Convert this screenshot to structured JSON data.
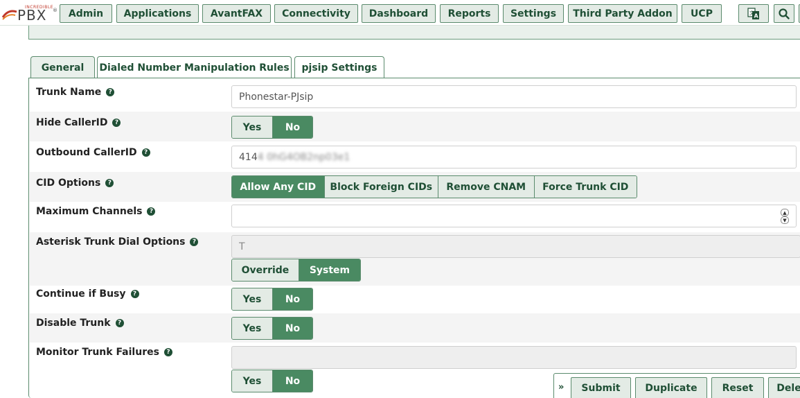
{
  "brand": {
    "small": "INCREDIBLE",
    "big": "PBX",
    "mark": "®"
  },
  "nav": [
    {
      "label": "Admin"
    },
    {
      "label": "Applications"
    },
    {
      "label": "AvantFAX"
    },
    {
      "label": "Connectivity"
    },
    {
      "label": "Dashboard"
    },
    {
      "label": "Reports"
    },
    {
      "label": "Settings"
    },
    {
      "label": "Third Party Addon"
    },
    {
      "label": "UCP"
    }
  ],
  "nav_icons": [
    "translate-icon",
    "search-icon"
  ],
  "tabs": [
    {
      "label": "General",
      "active": true
    },
    {
      "label": "Dialed Number Manipulation Rules",
      "active": false
    },
    {
      "label": "pjsip Settings",
      "active": false
    }
  ],
  "form": {
    "trunk_name": {
      "label": "Trunk Name",
      "value": "Phonestar-PJsip"
    },
    "hide_callerid": {
      "label": "Hide CallerID",
      "options": [
        "Yes",
        "No"
      ],
      "selected": "No"
    },
    "outbound_callerid": {
      "label": "Outbound CallerID",
      "value_prefix": "414",
      "value_blurred": "4 0hG4OB2np03e1"
    },
    "cid_options": {
      "label": "CID Options",
      "options": [
        "Allow Any CID",
        "Block Foreign CIDs",
        "Remove CNAM",
        "Force Trunk CID"
      ],
      "selected": "Allow Any CID"
    },
    "max_channels": {
      "label": "Maximum Channels",
      "value": ""
    },
    "dial_options": {
      "label": "Asterisk Trunk Dial Options",
      "value": "T",
      "options": [
        "Override",
        "System"
      ],
      "selected": "System"
    },
    "continue_if_busy": {
      "label": "Continue if Busy",
      "options": [
        "Yes",
        "No"
      ],
      "selected": "No"
    },
    "disable_trunk": {
      "label": "Disable Trunk",
      "options": [
        "Yes",
        "No"
      ],
      "selected": "No"
    },
    "monitor_failures": {
      "label": "Monitor Trunk Failures",
      "value": "",
      "options": [
        "Yes",
        "No"
      ],
      "selected": "No"
    }
  },
  "help_glyph": "?",
  "footer": {
    "chevron": "»",
    "submit": "Submit",
    "duplicate": "Duplicate",
    "reset": "Reset",
    "delete": "Dele"
  },
  "colors": {
    "accent": "#4a8a62",
    "button_bg": "#e3ebe5",
    "text_dark": "#1f4f35"
  }
}
